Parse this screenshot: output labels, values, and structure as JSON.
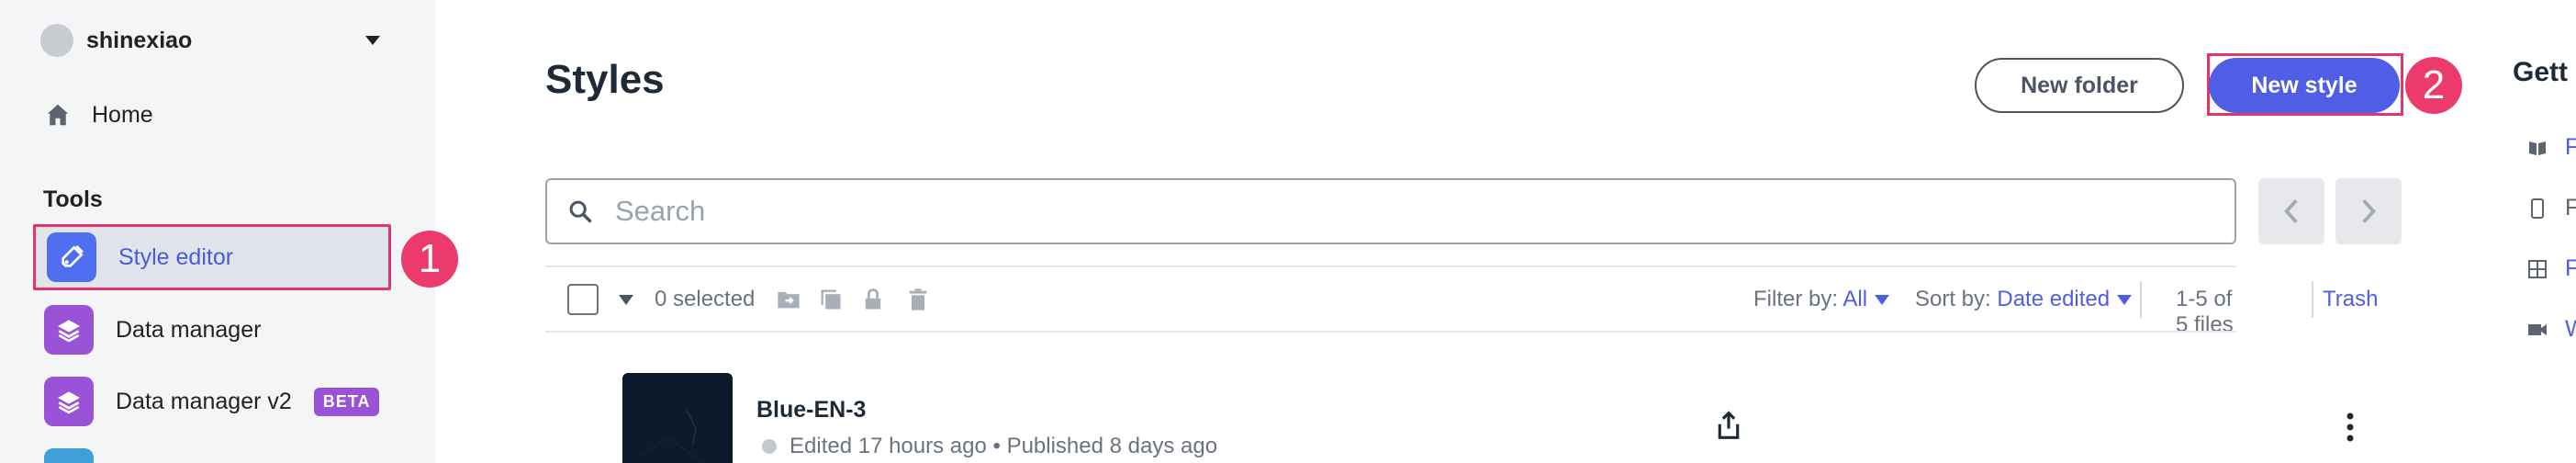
{
  "sidebar": {
    "user": {
      "name": "shinexiao"
    },
    "home_label": "Home",
    "tools_title": "Tools",
    "items": [
      {
        "label": "Style editor",
        "icon": "style-editor-icon",
        "color": "#4f6ef0"
      },
      {
        "label": "Data manager",
        "icon": "data-manager-icon",
        "color": "#9a52d6"
      },
      {
        "label": "Data manager v2",
        "icon": "data-manager-icon",
        "color": "#9a52d6",
        "badge": "BETA"
      }
    ]
  },
  "callouts": {
    "one": "1",
    "two": "2"
  },
  "header": {
    "title": "Styles",
    "new_folder_label": "New folder",
    "new_style_label": "New style"
  },
  "search": {
    "placeholder": "Search",
    "value": ""
  },
  "toolbar": {
    "selected_text": "0 selected",
    "filter_label": "Filter by:",
    "filter_value": "All",
    "sort_label": "Sort by:",
    "sort_value": "Date edited",
    "files_count": "1-5 of 5 files",
    "trash_label": "Trash"
  },
  "styles": [
    {
      "name": "Blue-EN-3",
      "status": "Edited 17 hours ago • Published 8 days ago"
    }
  ],
  "right_panel": {
    "title": "Gett"
  },
  "colors": {
    "accent": "#4f5ee5",
    "highlight": "#e2356b",
    "badge": "#9a52d6"
  }
}
